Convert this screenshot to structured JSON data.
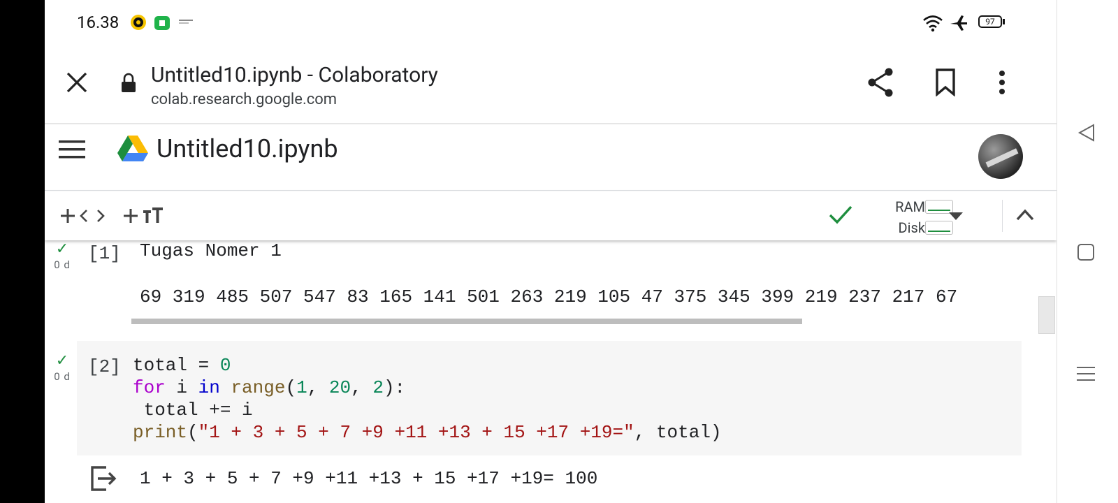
{
  "status_bar": {
    "time": "16.38",
    "battery": "97"
  },
  "browser": {
    "title": "Untitled10.ipynb - Colaboratory",
    "url": "colab.research.google.com"
  },
  "colab": {
    "notebook_name": "Untitled10.ipynb"
  },
  "toolbar": {
    "ram_label": "RAM",
    "disk_label": "Disk"
  },
  "cells": [
    {
      "exec_count": "[1]",
      "duration": "0 d",
      "text": "Tugas Nomer 1",
      "output": "69 319 485 507 547 83 165 141 501 263 219 105 47 375 345 399 219 237 217 67"
    },
    {
      "exec_count": "[2]",
      "duration": "0 d",
      "code": {
        "l1_var": "total",
        "l1_op": " = ",
        "l1_num": "0",
        "l2_for": "for",
        "l2_i": " i ",
        "l2_in": "in",
        "l2_range": " range",
        "l2_open": "(",
        "l2_a": "1",
        "l2_c1": ", ",
        "l2_b": "20",
        "l2_c2": ", ",
        "l2_c": "2",
        "l2_close": "):",
        "l3": " total += i",
        "l4_print": "print",
        "l4_open": "(",
        "l4_str": "\"1 + 3 + 5 + 7 +9 +11 +13 + 15 +17 +19=\"",
        "l4_rest": ", total)"
      },
      "output": "1 + 3 + 5 + 7 +9 +11 +13 + 15 +17 +19= 100"
    }
  ]
}
